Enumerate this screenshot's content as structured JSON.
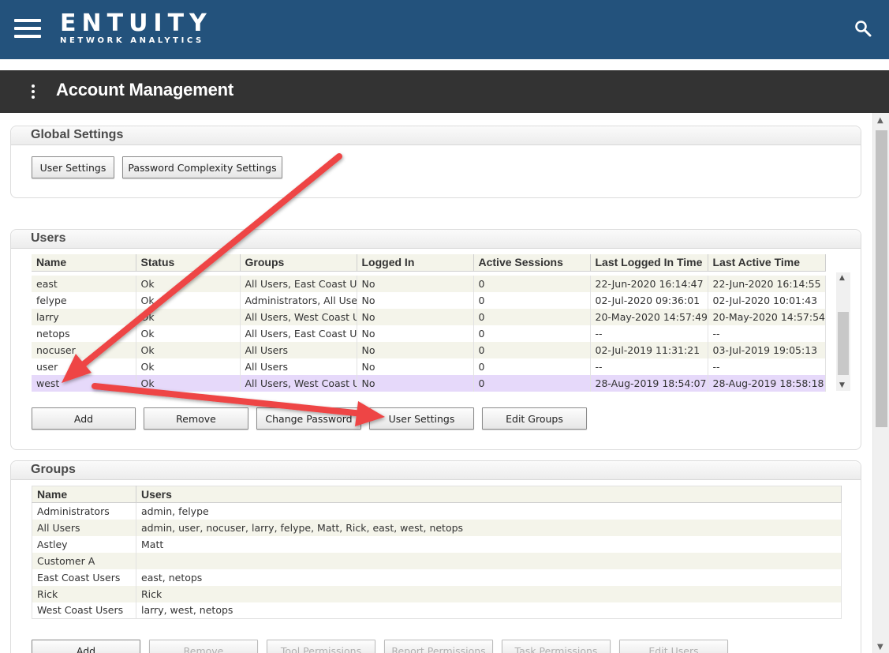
{
  "header": {
    "brand_name": "ENTUITY",
    "brand_tagline": "NETWORK ANALYTICS"
  },
  "page": {
    "title": "Account Management"
  },
  "global_settings": {
    "title": "Global Settings",
    "buttons": {
      "user_settings": "User Settings",
      "password_complexity": "Password Complexity Settings"
    }
  },
  "users": {
    "title": "Users",
    "columns": [
      "Name",
      "Status",
      "Groups",
      "Logged In",
      "Active Sessions",
      "Last Logged In Time",
      "Last Active Time"
    ],
    "rows": [
      {
        "name": "east",
        "status": "Ok",
        "groups": "All Users, East Coast Users",
        "logged_in": "No",
        "sessions": "0",
        "last_login": "22-Jun-2020 16:14:47",
        "last_active": "22-Jun-2020 16:14:55"
      },
      {
        "name": "felype",
        "status": "Ok",
        "groups": "Administrators, All Users",
        "logged_in": "No",
        "sessions": "0",
        "last_login": "02-Jul-2020 09:36:01",
        "last_active": "02-Jul-2020 10:01:43"
      },
      {
        "name": "larry",
        "status": "Ok",
        "groups": "All Users, West Coast Users",
        "logged_in": "No",
        "sessions": "0",
        "last_login": "20-May-2020 14:57:49",
        "last_active": "20-May-2020 14:57:54"
      },
      {
        "name": "netops",
        "status": "Ok",
        "groups": "All Users, East Coast Users",
        "logged_in": "No",
        "sessions": "0",
        "last_login": "--",
        "last_active": "--"
      },
      {
        "name": "nocuser",
        "status": "Ok",
        "groups": "All Users",
        "logged_in": "No",
        "sessions": "0",
        "last_login": "02-Jul-2019 11:31:21",
        "last_active": "03-Jul-2019 19:05:13"
      },
      {
        "name": "user",
        "status": "Ok",
        "groups": "All Users",
        "logged_in": "No",
        "sessions": "0",
        "last_login": "--",
        "last_active": "--"
      },
      {
        "name": "west",
        "status": "Ok",
        "groups": "All Users, West Coast Users",
        "logged_in": "No",
        "sessions": "0",
        "last_login": "28-Aug-2019 18:54:07",
        "last_active": "28-Aug-2019 18:58:18"
      }
    ],
    "selected_row": "west",
    "buttons": {
      "add": "Add",
      "remove": "Remove",
      "change_password": "Change Password",
      "user_settings": "User Settings",
      "edit_groups": "Edit Groups"
    }
  },
  "groups": {
    "title": "Groups",
    "columns": [
      "Name",
      "Users"
    ],
    "rows": [
      {
        "name": "Administrators",
        "users": "admin, felype"
      },
      {
        "name": "All Users",
        "users": "admin, user, nocuser, larry, felype, Matt, Rick, east, west, netops"
      },
      {
        "name": "Astley",
        "users": "Matt"
      },
      {
        "name": "Customer A",
        "users": ""
      },
      {
        "name": "East Coast Users",
        "users": "east, netops"
      },
      {
        "name": "Rick",
        "users": "Rick"
      },
      {
        "name": "West Coast Users",
        "users": "larry, west, netops"
      }
    ],
    "buttons": {
      "add": "Add",
      "remove": "Remove",
      "tool_permissions": "Tool Permissions",
      "report_permissions": "Report Permissions",
      "task_permissions": "Task Permissions",
      "edit_users": "Edit Users"
    }
  },
  "colors": {
    "header_bg": "#23527c",
    "titlebar_bg": "#333333",
    "row_alt": "#f4f4ea",
    "row_selected": "#e6d9fa",
    "annotation_arrow": "#ee4444"
  },
  "icons": {
    "menu": "hamburger-icon",
    "search": "search-icon",
    "page_menu": "kebab-icon"
  }
}
